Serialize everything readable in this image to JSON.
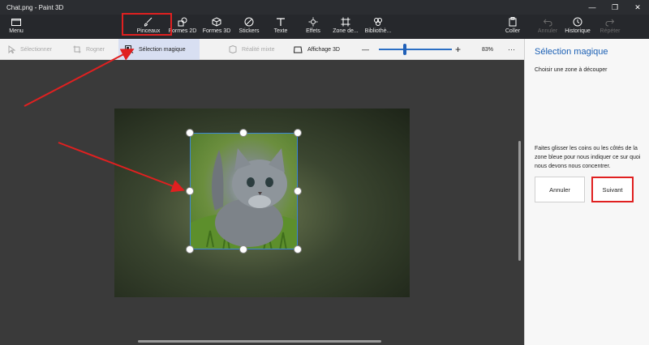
{
  "window": {
    "title": "Chat.png - Paint 3D",
    "controls": [
      "—",
      "❐",
      "✕"
    ]
  },
  "ribbon": {
    "menu": "Menu",
    "tools": [
      {
        "label": "Pinceaux",
        "icon": "brush-icon"
      },
      {
        "label": "Formes 2D",
        "icon": "shapes-2d-icon"
      },
      {
        "label": "Formes 3D",
        "icon": "shapes-3d-icon"
      },
      {
        "label": "Stickers",
        "icon": "sticker-icon"
      },
      {
        "label": "Texte",
        "icon": "text-icon"
      },
      {
        "label": "Effets",
        "icon": "effects-icon"
      },
      {
        "label": "Zone de...",
        "icon": "canvas-icon"
      },
      {
        "label": "Bibliothè...",
        "icon": "library-icon"
      }
    ],
    "right": [
      {
        "label": "Coller",
        "icon": "paste-icon",
        "disabled": false
      },
      {
        "label": "Annuler",
        "icon": "undo-icon",
        "disabled": true
      },
      {
        "label": "Historique",
        "icon": "history-icon",
        "disabled": false
      },
      {
        "label": "Répéter",
        "icon": "redo-icon",
        "disabled": true
      }
    ]
  },
  "toolbar": {
    "select": "Sélectionner",
    "crop": "Rogner",
    "magic_select": "Sélection magique",
    "mixed_reality": "Réalité mixte",
    "view_3d": "Affichage 3D",
    "zoom_minus": "—",
    "zoom_plus": "+",
    "zoom_level": "83%",
    "zoom_fraction": 0.35,
    "more": "···"
  },
  "panel": {
    "title": "Sélection magique",
    "subtitle": "Choisir une zone à découper",
    "description": "Faites glisser les coins ou les côtés de la zone bleue pour nous indiquer ce sur quoi nous devons nous concentrer.",
    "cancel": "Annuler",
    "next": "Suivant"
  },
  "colors": {
    "annotation_red": "#e02020",
    "accent_blue": "#1a5fb4",
    "selection_border": "#3a86d6"
  }
}
